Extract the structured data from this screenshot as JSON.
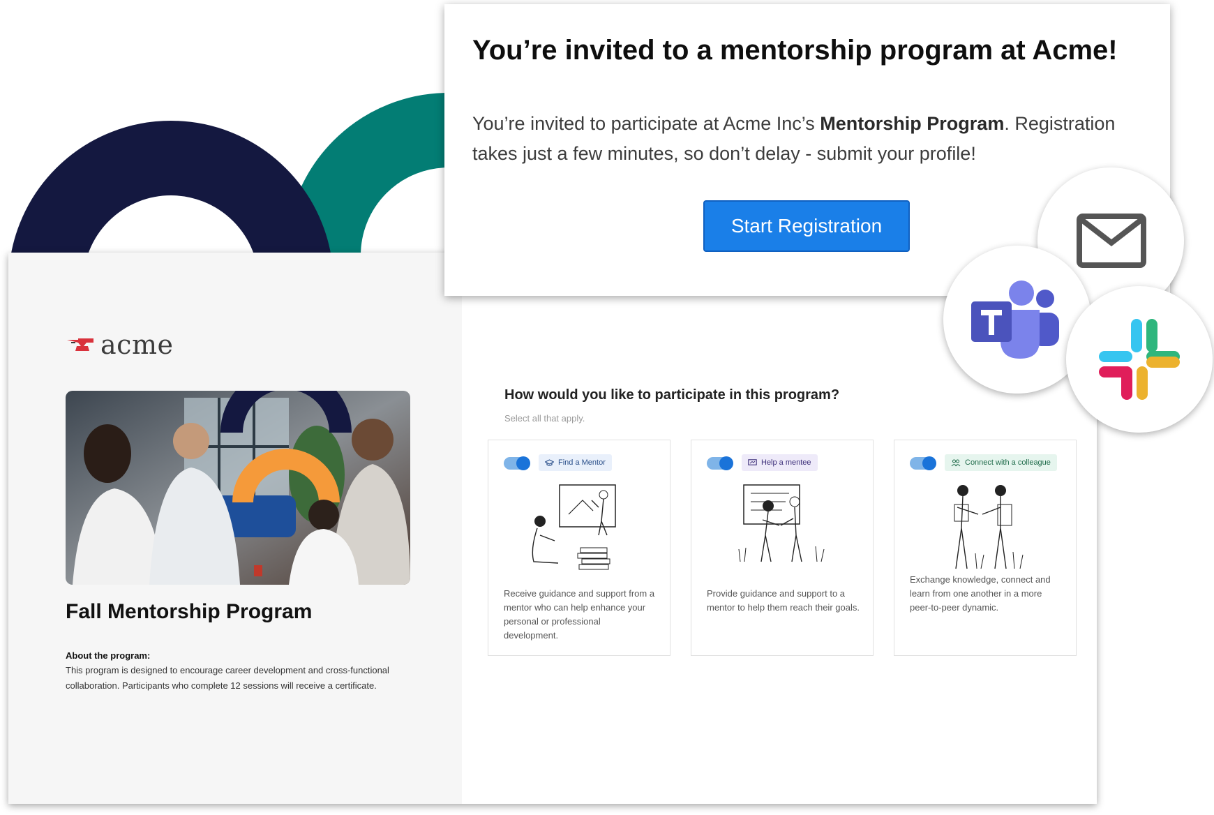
{
  "invitation": {
    "title": "You’re invited to a mentorship program at Acme!",
    "body_prefix": "You’re invited to participate at Acme Inc’s ",
    "body_bold": "Mentorship Program",
    "body_suffix": ". Registration takes just a few minutes, so don’t delay - submit your profile!",
    "cta_label": "Start Registration"
  },
  "brand": {
    "logo_text": "acme",
    "colors": {
      "navy": "#141840",
      "teal": "#037D74",
      "orange": "#F59A3A",
      "primary": "#1A7FE8",
      "logo_red": "#D9323C"
    }
  },
  "program": {
    "title": "Fall Mentorship Program",
    "about_heading": "About the program:",
    "about_body": "This program is designed to encourage career development and cross-functional collaboration. Participants who complete 12 sessions will receive a certificate."
  },
  "participation": {
    "question": "How would you like to participate in this program?",
    "hint": "Select all that apply.",
    "options": [
      {
        "label": "Find a Mentor",
        "icon": "graduation-cap-icon",
        "enabled": true,
        "description": "Receive guidance and support from a mentor who can help enhance your personal or professional development."
      },
      {
        "label": "Help a mentee",
        "icon": "presentation-icon",
        "enabled": true,
        "description": "Provide guidance and support to a mentor to help them reach their goals."
      },
      {
        "label": "Connect with a colleague",
        "icon": "people-icon",
        "enabled": true,
        "description": "Exchange knowledge, connect and learn from one another in a more peer-to-peer dynamic."
      }
    ]
  },
  "channels": [
    {
      "name": "email",
      "icon": "mail-icon"
    },
    {
      "name": "teams",
      "icon": "microsoft-teams-icon"
    },
    {
      "name": "slack",
      "icon": "slack-icon"
    }
  ]
}
